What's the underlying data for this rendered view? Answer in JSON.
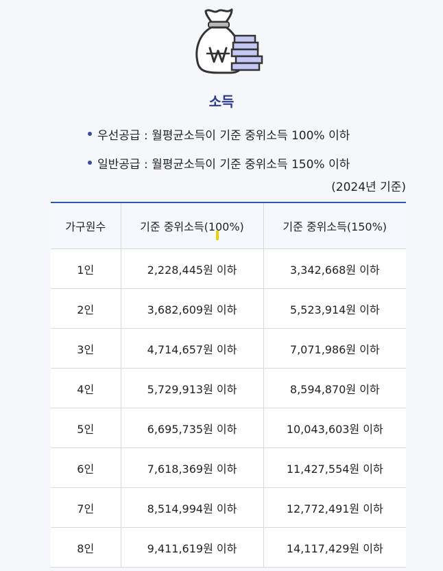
{
  "header": {
    "icon": "money-bag-won-icon",
    "title": "소득"
  },
  "bullets": [
    "우선공급 : 월평균소득이 기준 중위소득 100% 이하",
    "일반공급 : 월평균소득이 기준 중위소득 150% 이하"
  ],
  "basis_note": "(2024년 기준)",
  "table": {
    "headers": [
      "가구원수",
      "기준 중위소득(100%)",
      "기준 중위소득(150%)"
    ],
    "rows": [
      {
        "household": "1인",
        "income_100": "2,228,445원 이하",
        "income_150": "3,342,668원 이하"
      },
      {
        "household": "2인",
        "income_100": "3,682,609원 이하",
        "income_150": "5,523,914원 이하"
      },
      {
        "household": "3인",
        "income_100": "4,714,657원 이하",
        "income_150": "7,071,986원 이하"
      },
      {
        "household": "4인",
        "income_100": "5,729,913원 이하",
        "income_150": "8,594,870원 이하"
      },
      {
        "household": "5인",
        "income_100": "6,695,735원 이하",
        "income_150": "10,043,603원 이하"
      },
      {
        "household": "6인",
        "income_100": "7,618,369원 이하",
        "income_150": "11,427,554원 이하"
      },
      {
        "household": "7인",
        "income_100": "8,514,994원 이하",
        "income_150": "12,772,491원 이하"
      },
      {
        "household": "8인",
        "income_100": "9,411,619원 이하",
        "income_150": "14,117,429원 이하"
      }
    ]
  },
  "colors": {
    "title": "#2b3b8f",
    "table_top_border": "#2f55b3",
    "coins": "#c5c8f5",
    "icon_stroke": "#333333"
  }
}
